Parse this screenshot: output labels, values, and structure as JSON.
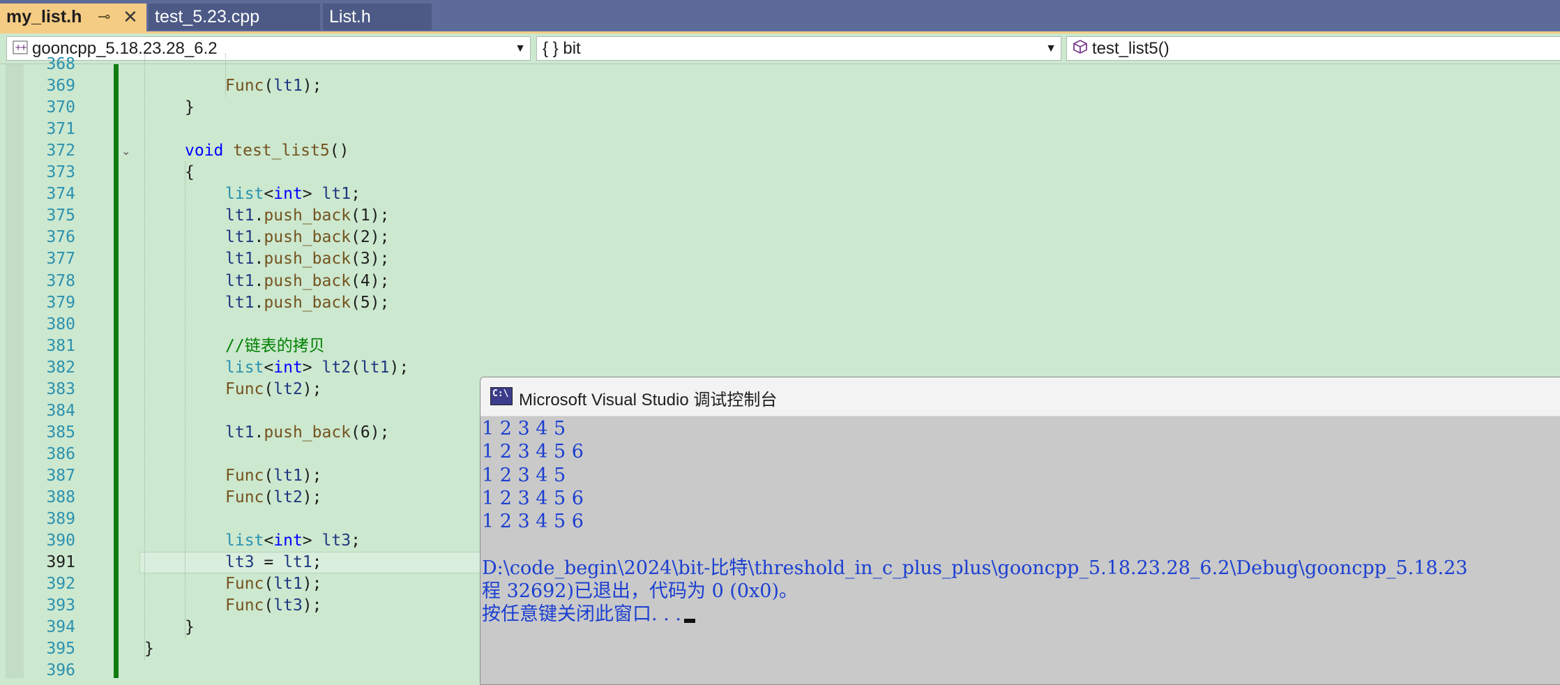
{
  "tabs": [
    {
      "label": "my_list.h",
      "active": true
    },
    {
      "label": "test_5.23.cpp",
      "active": false
    },
    {
      "label": "List.h",
      "active": false
    }
  ],
  "nav": {
    "project": "gooncpp_5.18.23.28_6.2",
    "scope": "{ } bit",
    "member": "test_list5()"
  },
  "editor": {
    "current_line": 391,
    "lines": [
      {
        "num": "368",
        "code": ""
      },
      {
        "num": "369",
        "code": "Func(lt1);"
      },
      {
        "num": "370",
        "code": "}"
      },
      {
        "num": "371",
        "code": ""
      },
      {
        "num": "372",
        "code": "void test_list5()"
      },
      {
        "num": "373",
        "code": "{"
      },
      {
        "num": "374",
        "code": "list<int> lt1;"
      },
      {
        "num": "375",
        "code": "lt1.push_back(1);"
      },
      {
        "num": "376",
        "code": "lt1.push_back(2);"
      },
      {
        "num": "377",
        "code": "lt1.push_back(3);"
      },
      {
        "num": "378",
        "code": "lt1.push_back(4);"
      },
      {
        "num": "379",
        "code": "lt1.push_back(5);"
      },
      {
        "num": "380",
        "code": ""
      },
      {
        "num": "381",
        "code": "//链表的拷贝"
      },
      {
        "num": "382",
        "code": "list<int> lt2(lt1);"
      },
      {
        "num": "383",
        "code": "Func(lt2);"
      },
      {
        "num": "384",
        "code": ""
      },
      {
        "num": "385",
        "code": "lt1.push_back(6);"
      },
      {
        "num": "386",
        "code": ""
      },
      {
        "num": "387",
        "code": "Func(lt1);"
      },
      {
        "num": "388",
        "code": "Func(lt2);"
      },
      {
        "num": "389",
        "code": ""
      },
      {
        "num": "390",
        "code": "list<int> lt3;"
      },
      {
        "num": "391",
        "code": "lt3 = lt1;"
      },
      {
        "num": "392",
        "code": "Func(lt1);"
      },
      {
        "num": "393",
        "code": "Func(lt3);"
      },
      {
        "num": "394",
        "code": "}"
      },
      {
        "num": "395",
        "code": "}"
      },
      {
        "num": "396",
        "code": ""
      }
    ]
  },
  "console": {
    "title": "Microsoft Visual Studio 调试控制台",
    "icon_text": "C:\\",
    "output": [
      "1 2 3 4 5",
      "1 2 3 4 5 6",
      "1 2 3 4 5",
      "1 2 3 4 5 6",
      "1 2 3 4 5 6",
      "",
      "D:\\code_begin\\2024\\bit-比特\\threshold_in_c_plus_plus\\gooncpp_5.18.23.28_6.2\\Debug\\gooncpp_5.18.23",
      "程 32692)已退出，代码为 0 (0x0)。",
      "按任意键关闭此窗口. . ."
    ]
  },
  "colors": {
    "editor_bg": "#cce8cf",
    "keyword": "#0000ff",
    "function": "#74531f",
    "type": "#2b91af",
    "comment": "#008000",
    "line_number": "#2b91af",
    "console_text": "#1b3fd0",
    "console_bg": "#c9c9c9",
    "active_tab": "#f5cc84",
    "tabbar": "#5d6b99"
  }
}
